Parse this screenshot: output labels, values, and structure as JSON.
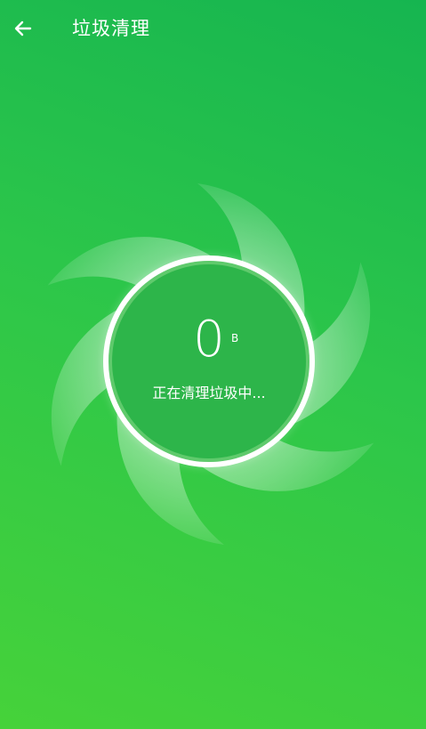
{
  "header": {
    "back_icon": "arrow-left-icon",
    "title": "垃圾清理"
  },
  "scan": {
    "size_value": "0",
    "size_unit": "B",
    "status": "正在清理垃圾中..."
  },
  "colors": {
    "background_top": "#16b550",
    "background_bottom": "#46d23a",
    "circle_fill": "#2db54a",
    "text": "#ffffff"
  }
}
